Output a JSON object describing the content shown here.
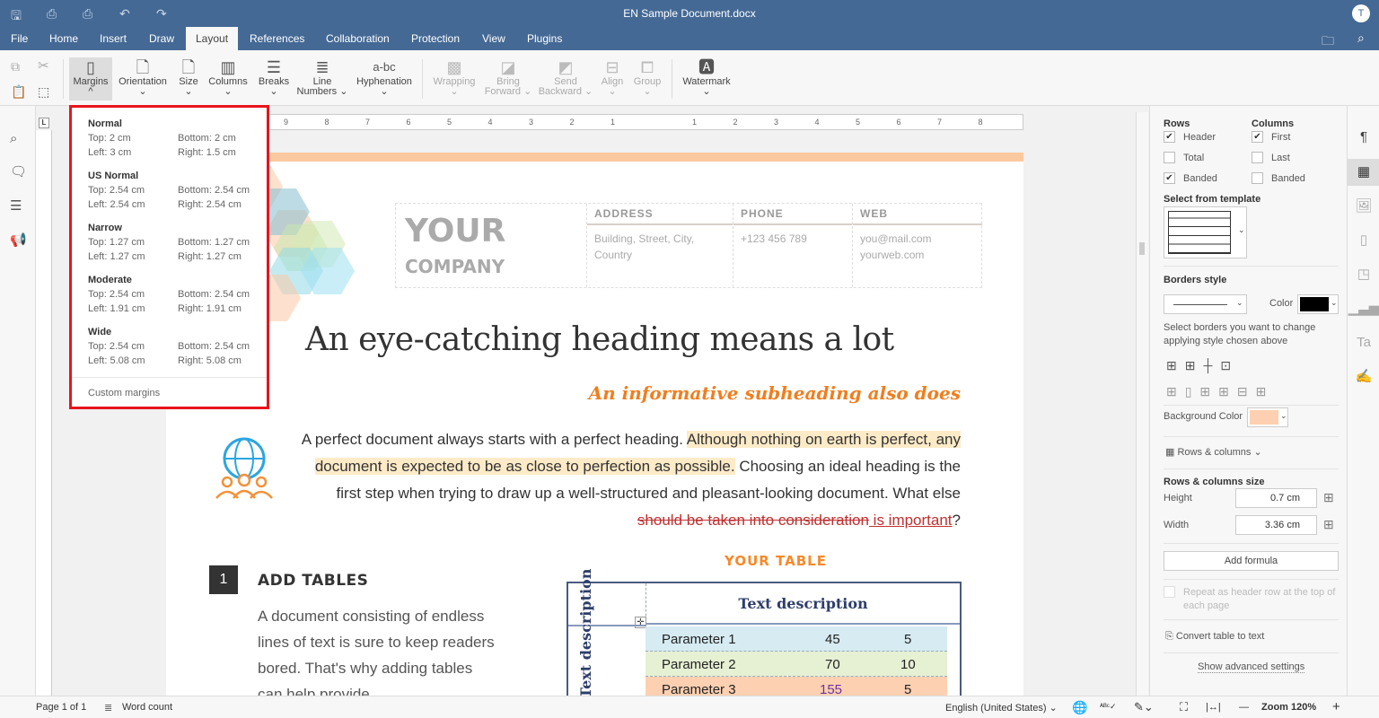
{
  "app": {
    "title": "EN Sample Document.docx",
    "user_initial": "T"
  },
  "menu": {
    "tabs": [
      "File",
      "Home",
      "Insert",
      "Draw",
      "Layout",
      "References",
      "Collaboration",
      "Protection",
      "View",
      "Plugins"
    ],
    "active": "Layout"
  },
  "toolbar": {
    "margins": "Margins",
    "orientation": "Orientation",
    "size": "Size",
    "columns": "Columns",
    "breaks": "Breaks",
    "line_numbers_1": "Line",
    "line_numbers_2": "Numbers",
    "hyphenation": "Hyphenation",
    "wrapping": "Wrapping",
    "bring_1": "Bring",
    "bring_2": "Forward",
    "send_1": "Send",
    "send_2": "Backward",
    "align": "Align",
    "group": "Group",
    "watermark": "Watermark"
  },
  "margins_menu": {
    "items": [
      {
        "name": "Normal",
        "top": "Top: 2 cm",
        "bottom": "Bottom: 2 cm",
        "left": "Left: 3 cm",
        "right": "Right: 1.5 cm"
      },
      {
        "name": "US Normal",
        "top": "Top: 2.54 cm",
        "bottom": "Bottom: 2.54 cm",
        "left": "Left: 2.54 cm",
        "right": "Right: 2.54 cm"
      },
      {
        "name": "Narrow",
        "top": "Top: 1.27 cm",
        "bottom": "Bottom: 1.27 cm",
        "left": "Left: 1.27 cm",
        "right": "Right: 1.27 cm"
      },
      {
        "name": "Moderate",
        "top": "Top: 2.54 cm",
        "bottom": "Bottom: 2.54 cm",
        "left": "Left: 1.91 cm",
        "right": "Right: 1.91 cm"
      },
      {
        "name": "Wide",
        "top": "Top: 2.54 cm",
        "bottom": "Bottom: 2.54 cm",
        "left": "Left: 5.08 cm",
        "right": "Right: 5.08 cm"
      }
    ],
    "custom": "Custom margins"
  },
  "ruler": {
    "left": [
      "9",
      "8",
      "7",
      "6",
      "5",
      "4",
      "3",
      "2",
      "1"
    ],
    "right": [
      "1",
      "2",
      "3",
      "4",
      "5",
      "6",
      "7",
      "8"
    ]
  },
  "document": {
    "company_1": "YOUR",
    "company_2": "COMPANY",
    "address_label": "ADDRESS",
    "address_1": "Building, Street, City,",
    "address_2": "Country",
    "phone_label": "PHONE",
    "phone": "+123 456 789",
    "web_label": "WEB",
    "email": "you@mail.com",
    "web": "yourweb.com",
    "heading": "An eye-catching heading means a lot",
    "subheading": "An informative subheading also does",
    "para_1": "A perfect document always starts with a perfect heading. ",
    "para_hl": "Although nothing on earth is perfect, any document is expected to be as close to perfection as possible.",
    "para_2": " Choosing an ideal heading is the first step when trying to draw up a well-structured and pleasant-looking document. What else ",
    "para_strike": "should be taken into consideration",
    "para_ins": " is important",
    "para_end": "?",
    "section_num": "1",
    "section_title": "ADD TABLES",
    "section_text": "A document consisting of endless lines of text is sure to keep readers bored. That's why adding tables can help provide",
    "table_title": "YOUR TABLE",
    "table_header": "Text description",
    "table_side": "Text description",
    "table_rows": [
      [
        "Parameter 1",
        "45",
        "5"
      ],
      [
        "Parameter 2",
        "70",
        "10"
      ],
      [
        "Parameter 3",
        "155",
        "5"
      ]
    ]
  },
  "right_panel": {
    "rows": "Rows",
    "columns": "Columns",
    "header": "Header",
    "total": "Total",
    "banded": "Banded",
    "first": "First",
    "last": "Last",
    "col_banded": "Banded",
    "checked": {
      "header": true,
      "total": false,
      "banded": true,
      "first": true,
      "last": false,
      "col_banded": false
    },
    "template": "Select from template",
    "borders_style": "Borders style",
    "color": "Color",
    "border_color": "#000000",
    "borders_hint_1": "Select borders you want to change",
    "borders_hint_2": "applying style chosen above",
    "background_color": "Background Color",
    "bg_color_value": "#fdd0b1",
    "rows_columns": "Rows & columns",
    "size_title": "Rows & columns size",
    "height": "Height",
    "height_value": "0.7 cm",
    "width": "Width",
    "width_value": "3.36 cm",
    "add_formula": "Add formula",
    "repeat_1": "Repeat as header row at the top of",
    "repeat_2": "each page",
    "convert": "Convert table to text",
    "advanced": "Show advanced settings"
  },
  "status": {
    "page": "Page 1 of 1",
    "word_count": "Word count",
    "language": "English (United States)",
    "zoom": "Zoom 120%"
  }
}
